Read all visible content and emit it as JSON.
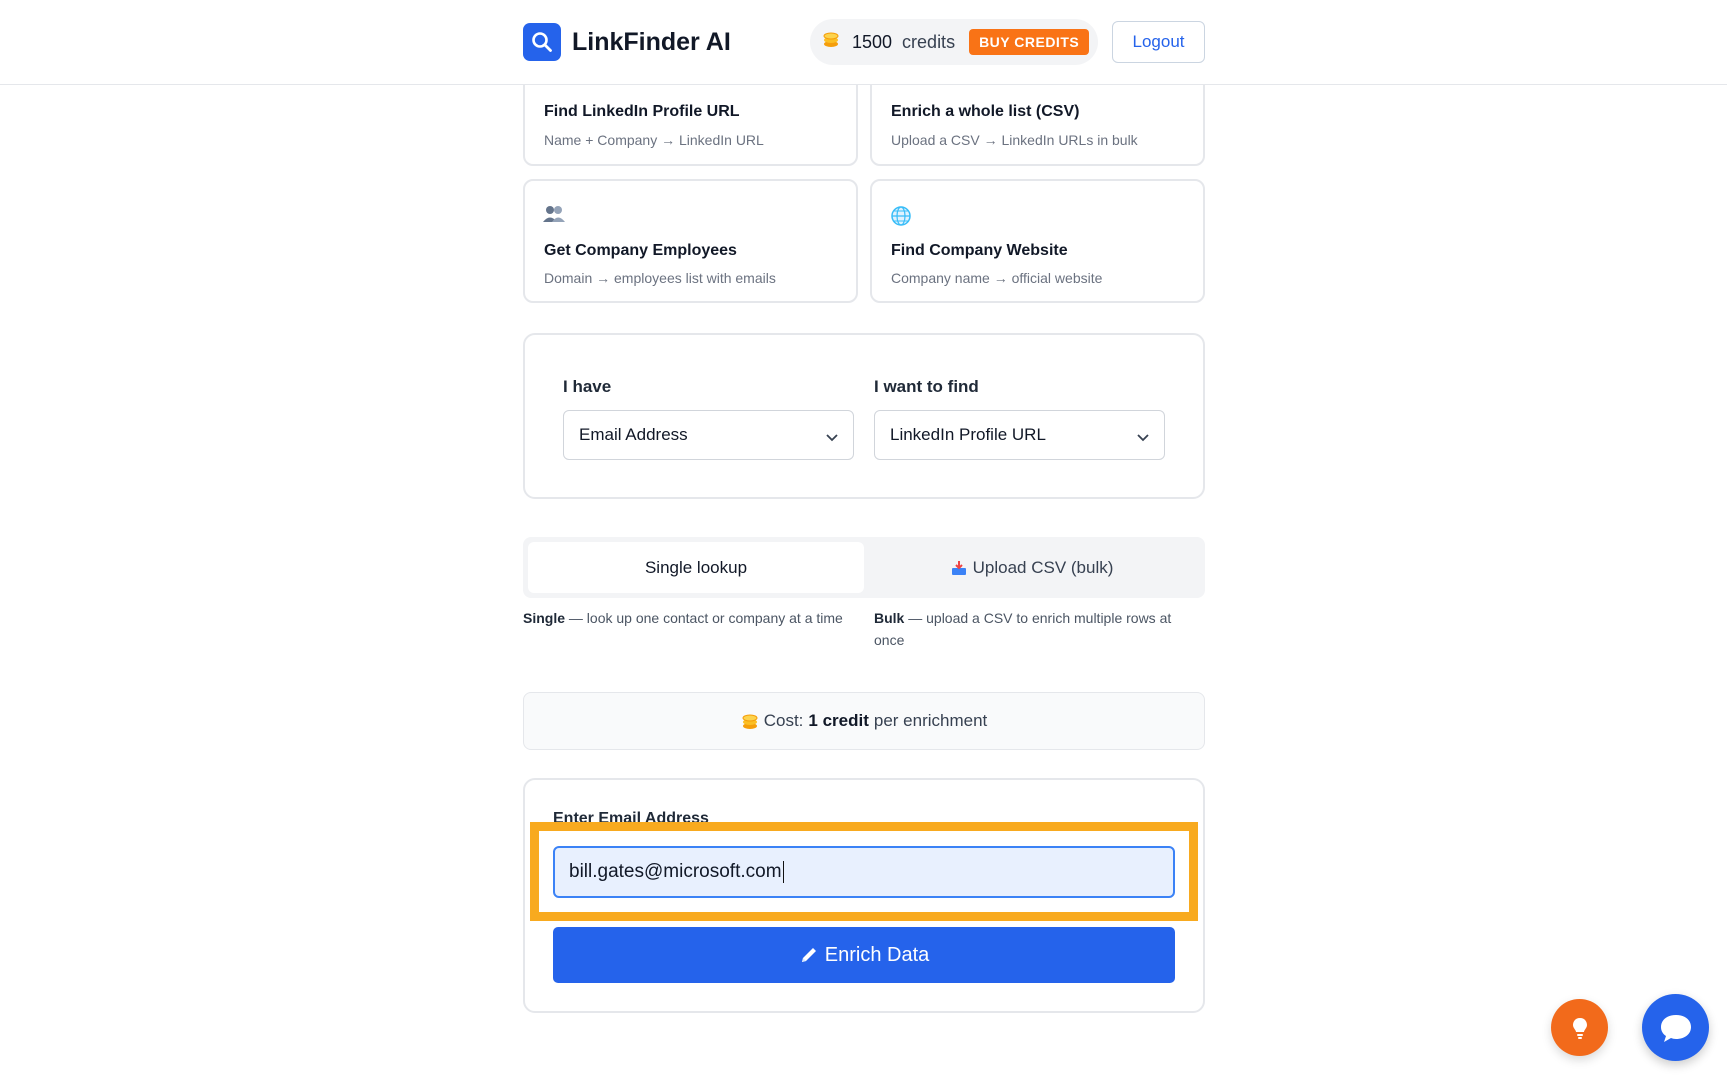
{
  "header": {
    "app_name": "LinkFinder AI",
    "credits_count": "1500",
    "credits_label": "credits",
    "buy_label": "BUY CREDITS",
    "logout_label": "Logout"
  },
  "features": [
    {
      "title": "Find LinkedIn Profile URL",
      "subtitle": "Name + Company → LinkedIn URL",
      "icon": "magnifier-icon"
    },
    {
      "title": "Enrich a whole list (CSV)",
      "subtitle": "Upload a CSV → LinkedIn URLs in bulk",
      "icon": "list-icon"
    },
    {
      "title": "Get Company Employees",
      "subtitle": "Domain → employees list with emails",
      "icon": "people-icon"
    },
    {
      "title": "Find Company Website",
      "subtitle": "Company name → official website",
      "icon": "globe-icon"
    }
  ],
  "selector": {
    "have_label": "I have",
    "have_value": "Email Address",
    "find_label": "I want to find",
    "find_value": "LinkedIn Profile URL"
  },
  "mode": {
    "single_tab": "Single lookup",
    "bulk_tab": "Upload CSV (bulk)",
    "single_strong": "Single",
    "single_desc": " — look up one contact or company at a time",
    "bulk_strong": "Bulk",
    "bulk_desc": " — upload a CSV to enrich multiple rows at once"
  },
  "cost": {
    "prefix": "Cost:",
    "amount": "1 credit",
    "suffix": "per enrichment"
  },
  "input": {
    "label": "Enter Email Address",
    "value": "bill.gates@microsoft.com",
    "button_label": "Enrich Data"
  },
  "colors": {
    "accent": "#2563eb",
    "buy": "#f97316",
    "highlight": "#f8aa1f",
    "tip_fab": "#f26a1b"
  }
}
